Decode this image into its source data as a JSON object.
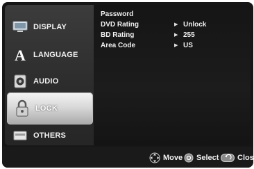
{
  "menu": {
    "items": [
      {
        "label": "DISPLAY",
        "icon": "tv-icon"
      },
      {
        "label": "LANGUAGE",
        "icon": "language-a-icon"
      },
      {
        "label": "AUDIO",
        "icon": "speaker-icon"
      },
      {
        "label": "LOCK",
        "icon": "padlock-icon",
        "selected": true
      },
      {
        "label": "OTHERS",
        "icon": "others-icon"
      }
    ]
  },
  "settings": {
    "rows": [
      {
        "name": "Password",
        "value": ""
      },
      {
        "name": "DVD Rating",
        "value": "Unlock"
      },
      {
        "name": "BD Rating",
        "value": "255"
      },
      {
        "name": "Area Code",
        "value": "US"
      }
    ]
  },
  "footer": {
    "move_label": "Move",
    "select_label": "Select",
    "close_label": "Close"
  }
}
